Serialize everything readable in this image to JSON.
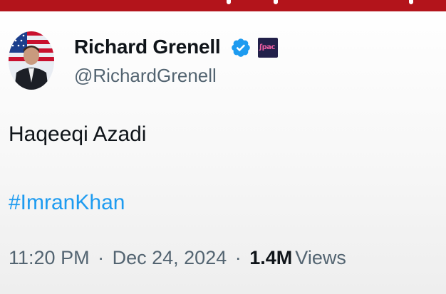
{
  "tweet": {
    "author": {
      "display_name": "Richard Grenell",
      "handle": "@RichardGrenell",
      "verified_icon": "verified-badge-icon",
      "affiliate_badge_icon": "affiliate-logo-icon"
    },
    "text": "Haqeeqi Azadi",
    "hashtag": "#ImranKhan",
    "time": "11:20 PM",
    "separator": "·",
    "date": "Dec 24, 2024",
    "views": {
      "count": "1.4M",
      "label": "Views"
    }
  },
  "colors": {
    "banner": "#b3141b",
    "text": "#0f1419",
    "muted": "#536471",
    "link": "#1d9bf0",
    "verified": "#1d9bf0"
  }
}
